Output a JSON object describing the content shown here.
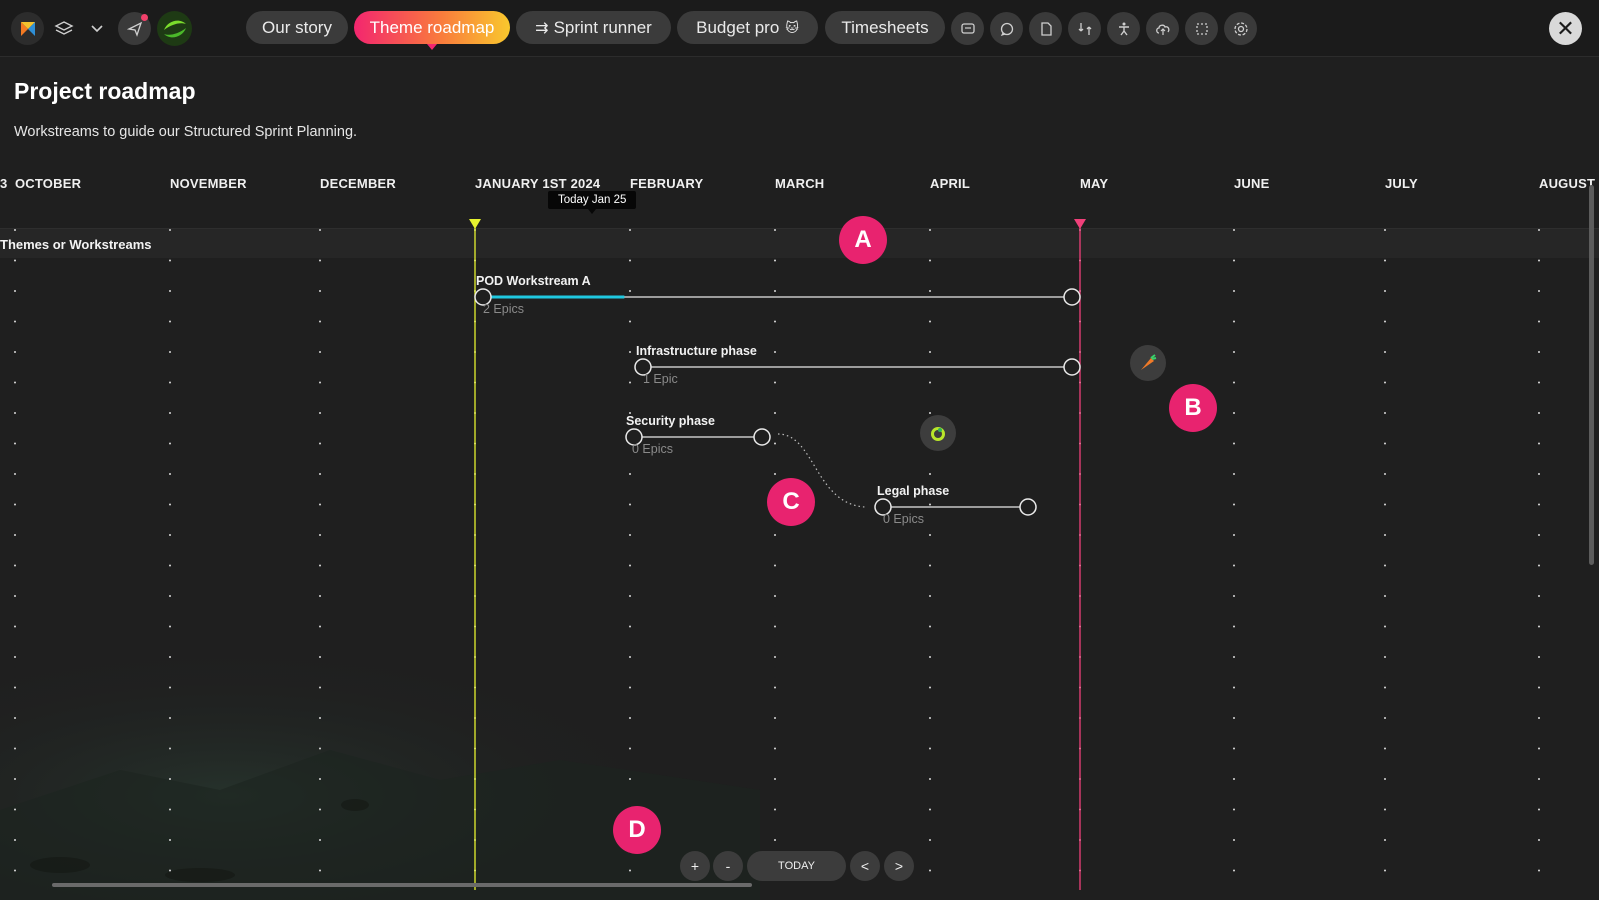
{
  "toolbar": {
    "tabs": [
      {
        "label": "Our story"
      },
      {
        "label": "Theme roadmap",
        "active": true
      },
      {
        "label": "Sprint runner",
        "icon": "runner-icon"
      },
      {
        "label": "Budget pro",
        "icon": "cat-emoji-icon"
      },
      {
        "label": "Timesheets"
      }
    ],
    "icons": [
      "logo-icon",
      "layers-icon",
      "chevron-down-icon",
      "send-icon",
      "green-avatar-icon",
      "comment-icon",
      "chat-bubble-icon",
      "document-icon",
      "compare-icon",
      "accessibility-icon",
      "cloud-sync-icon",
      "selection-icon",
      "settings-icon",
      "close-icon"
    ],
    "tab_glyphs": {
      "runner": "⇉",
      "budget": "🐱"
    }
  },
  "page": {
    "title": "Project roadmap",
    "subtitle": "Workstreams to guide our Structured Sprint Planning."
  },
  "timeline": {
    "months": [
      "3",
      "OCTOBER",
      "NOVEMBER",
      "DECEMBER",
      "JANUARY 1ST 2024",
      "FEBRUARY",
      "MARCH",
      "APRIL",
      "MAY",
      "JUNE",
      "JULY",
      "AUGUST"
    ],
    "today_label": "Today Jan 25",
    "start_marker_color": "#e6f22f",
    "end_marker_color": "#f0407a",
    "progress_color": "#1fc8e0",
    "row_header": "Themes or Workstreams"
  },
  "items": [
    {
      "name": "POD Workstream A",
      "sub": "2 Epics",
      "progress": 0.24
    },
    {
      "name": "Infrastructure phase",
      "sub": "1 Epic"
    },
    {
      "name": "Security phase",
      "sub": "0 Epics"
    },
    {
      "name": "Legal phase",
      "sub": "0 Epics"
    }
  ],
  "badges": [
    "A",
    "B",
    "C",
    "D"
  ],
  "controls": {
    "zoom_in": "+",
    "zoom_out": "-",
    "today": "TODAY",
    "prev": "<",
    "next": ">"
  },
  "close_glyph": "✕"
}
